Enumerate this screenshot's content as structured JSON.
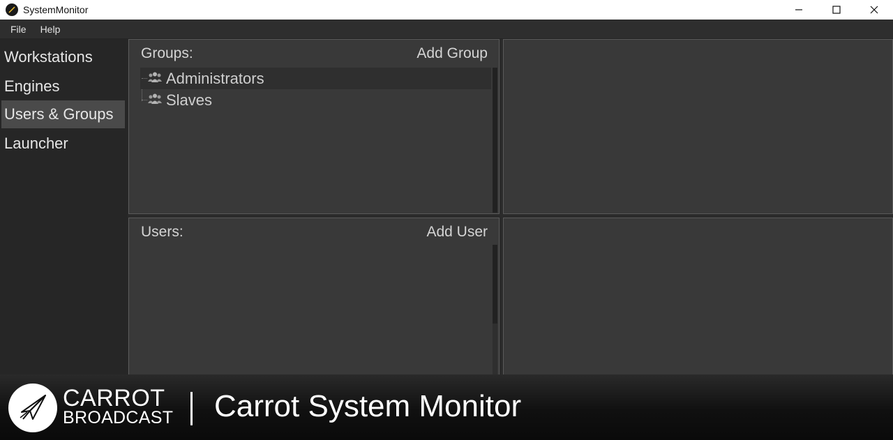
{
  "window": {
    "title": "SystemMonitor"
  },
  "menu": {
    "items": [
      "File",
      "Help"
    ]
  },
  "sidebar": {
    "items": [
      {
        "label": "Workstations",
        "active": false
      },
      {
        "label": "Engines",
        "active": false
      },
      {
        "label": "Users & Groups",
        "active": true
      },
      {
        "label": "Launcher",
        "active": false
      }
    ]
  },
  "groups_panel": {
    "title": "Groups:",
    "action": "Add Group",
    "items": [
      {
        "label": "Administrators",
        "selected": true,
        "icon": "users-group-icon"
      },
      {
        "label": "Slaves",
        "selected": false,
        "icon": "users-group-icon"
      }
    ]
  },
  "users_panel": {
    "title": "Users:",
    "action": "Add User"
  },
  "banner": {
    "brand_top": "CARROT",
    "brand_bottom": "BROADCAST",
    "title": "Carrot System Monitor",
    "logo_icon": "paper-plane-icon"
  },
  "colors": {
    "background": "#2b2b2b",
    "panel": "#393939",
    "sidebar_active": "#4a4a4a",
    "banner_text": "#ffffff"
  }
}
